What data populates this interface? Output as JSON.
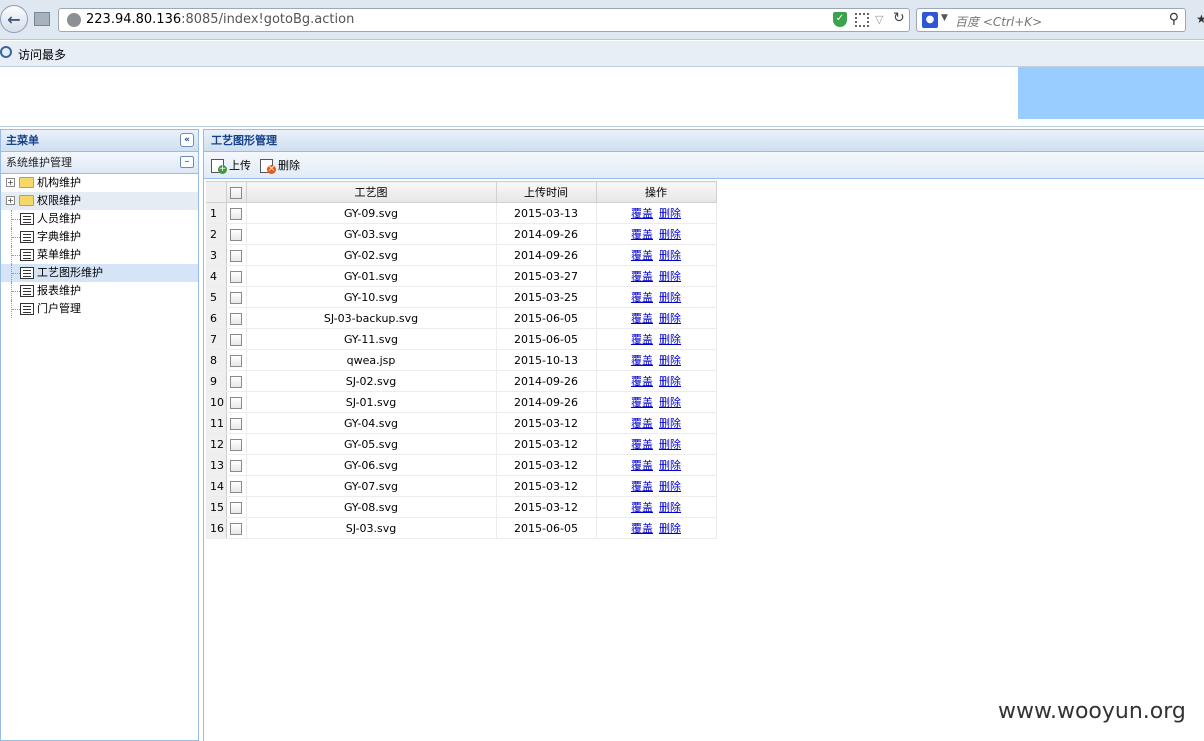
{
  "browser": {
    "url_host": "223.94.80.136",
    "url_rest": ":8085/index!gotoBg.action",
    "search_placeholder": "百度 <Ctrl+K>",
    "bookmark_label": "访问最多"
  },
  "left": {
    "title": "主菜单",
    "section": "系统维护管理",
    "items": [
      {
        "label": "机构维护",
        "type": "folder"
      },
      {
        "label": "权限维护",
        "type": "folder"
      },
      {
        "label": "人员维护",
        "type": "leaf"
      },
      {
        "label": "字典维护",
        "type": "leaf"
      },
      {
        "label": "菜单维护",
        "type": "leaf"
      },
      {
        "label": "工艺图形维护",
        "type": "leaf"
      },
      {
        "label": "报表维护",
        "type": "leaf"
      },
      {
        "label": "门户管理",
        "type": "leaf"
      }
    ]
  },
  "main": {
    "title": "工艺图形管理",
    "toolbar": {
      "upload": "上传",
      "delete": "删除"
    },
    "columns": {
      "name": "工艺图",
      "time": "上传时间",
      "ops": "操作"
    },
    "op_labels": {
      "cover": "覆盖",
      "delete": "删除"
    },
    "rows": [
      {
        "n": "1",
        "name": "GY-09.svg",
        "time": "2015-03-13"
      },
      {
        "n": "2",
        "name": "GY-03.svg",
        "time": "2014-09-26"
      },
      {
        "n": "3",
        "name": "GY-02.svg",
        "time": "2014-09-26"
      },
      {
        "n": "4",
        "name": "GY-01.svg",
        "time": "2015-03-27"
      },
      {
        "n": "5",
        "name": "GY-10.svg",
        "time": "2015-03-25"
      },
      {
        "n": "6",
        "name": "SJ-03-backup.svg",
        "time": "2015-06-05"
      },
      {
        "n": "7",
        "name": "GY-11.svg",
        "time": "2015-06-05"
      },
      {
        "n": "8",
        "name": "qwea.jsp",
        "time": "2015-10-13"
      },
      {
        "n": "9",
        "name": "SJ-02.svg",
        "time": "2014-09-26"
      },
      {
        "n": "10",
        "name": "SJ-01.svg",
        "time": "2014-09-26"
      },
      {
        "n": "11",
        "name": "GY-04.svg",
        "time": "2015-03-12"
      },
      {
        "n": "12",
        "name": "GY-05.svg",
        "time": "2015-03-12"
      },
      {
        "n": "13",
        "name": "GY-06.svg",
        "time": "2015-03-12"
      },
      {
        "n": "14",
        "name": "GY-07.svg",
        "time": "2015-03-12"
      },
      {
        "n": "15",
        "name": "GY-08.svg",
        "time": "2015-03-12"
      },
      {
        "n": "16",
        "name": "SJ-03.svg",
        "time": "2015-06-05"
      }
    ]
  },
  "watermark": "www.wooyun.org"
}
